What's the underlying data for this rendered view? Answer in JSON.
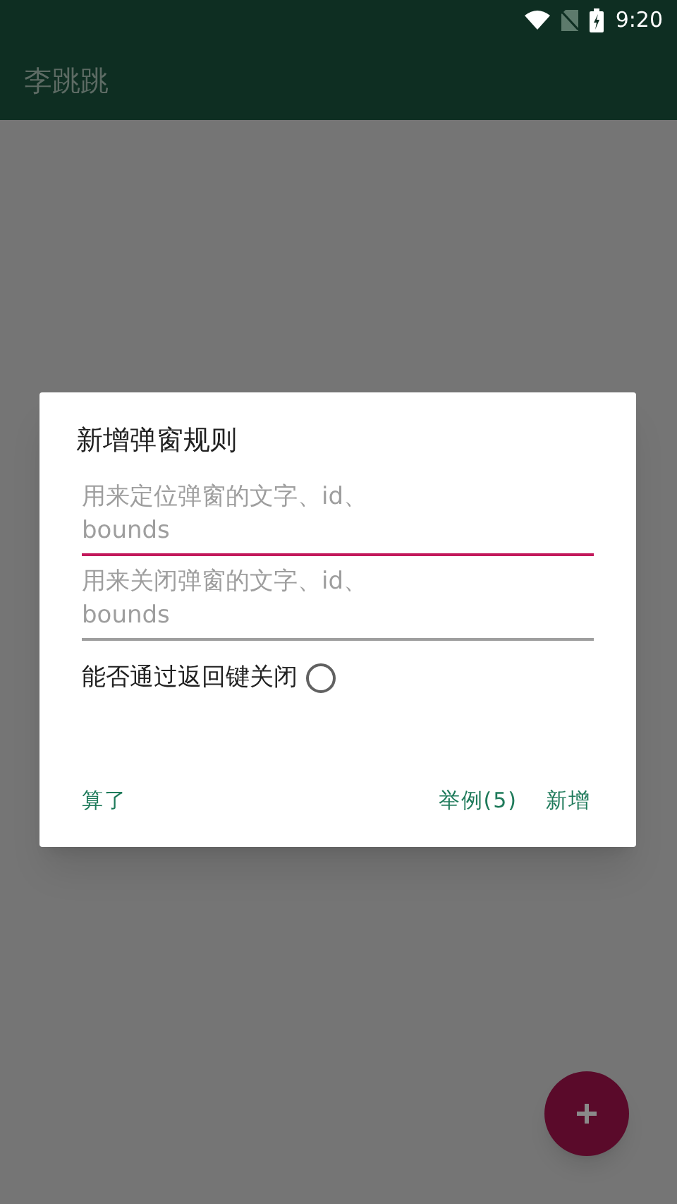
{
  "status_bar": {
    "time": "9:20"
  },
  "app_bar": {
    "title": "李跳跳"
  },
  "dialog": {
    "title": "新增弹窗规则",
    "fields": [
      {
        "placeholder": "用来定位弹窗的文字、id、\nbounds",
        "focused": true
      },
      {
        "placeholder": "用来关闭弹窗的文字、id、\nbounds",
        "focused": false
      }
    ],
    "option": {
      "label": "能否通过返回键关闭",
      "checked": false
    },
    "buttons": [
      {
        "label": "算了",
        "kind": "left"
      },
      {
        "label": "举例(5)",
        "kind": "right"
      },
      {
        "label": "新增",
        "kind": "right"
      }
    ]
  },
  "fab": {
    "kind": "add"
  }
}
